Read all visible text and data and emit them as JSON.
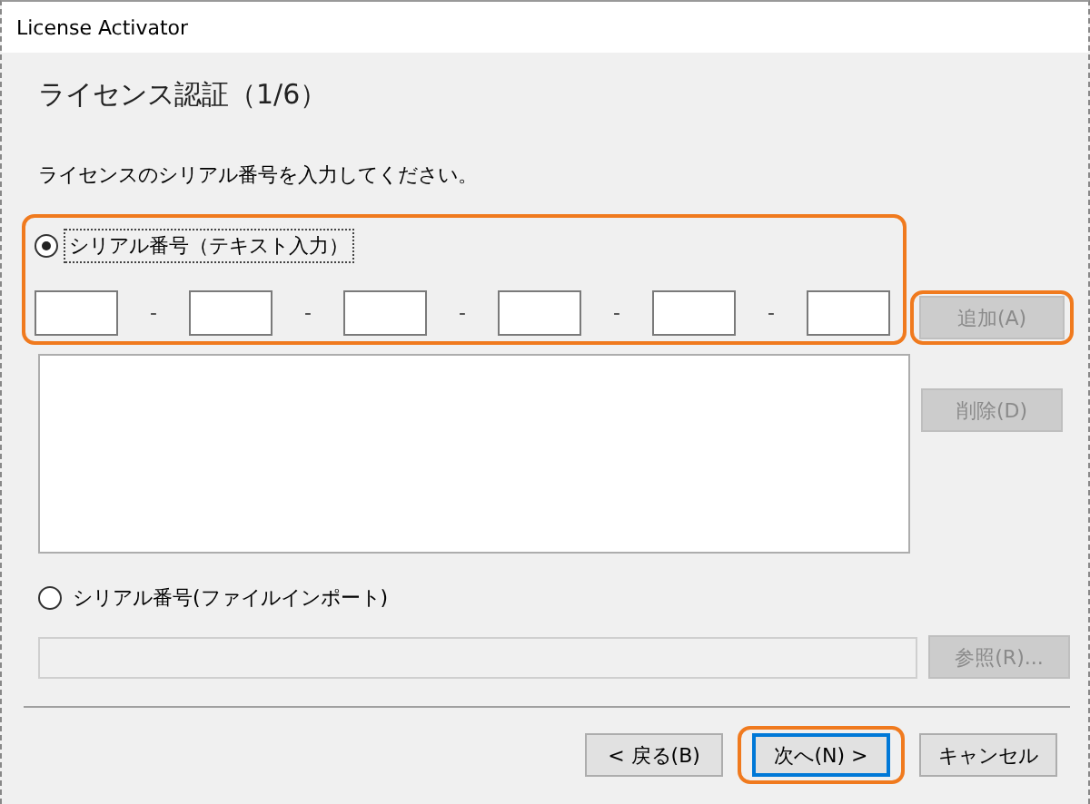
{
  "window": {
    "title": "License Activator"
  },
  "heading": "ライセンス認証（1/6）",
  "instruction": "ライセンスのシリアル番号を入力してください。",
  "serial_text": {
    "label": "シリアル番号（テキスト入力）",
    "selected": true,
    "focused": true,
    "highlighted": true,
    "separators": [
      "-",
      "-",
      "-",
      "-",
      "-"
    ]
  },
  "add_button": {
    "label": "追加(A)",
    "disabled": true,
    "highlighted": true
  },
  "delete_button": {
    "label": "削除(D)",
    "disabled": true
  },
  "serial_file": {
    "label": "シリアル番号(ファイルインポート)",
    "selected": false
  },
  "file_field": {
    "disabled": true
  },
  "browse_button": {
    "label": "参照(R)...",
    "disabled": true
  },
  "footer_buttons": [
    {
      "label": "< 戻る(B)",
      "default": false,
      "highlighted": false
    },
    {
      "label": "次へ(N) >",
      "default": true,
      "highlighted": true
    },
    {
      "label": "キャンセル",
      "default": false,
      "highlighted": false
    }
  ]
}
